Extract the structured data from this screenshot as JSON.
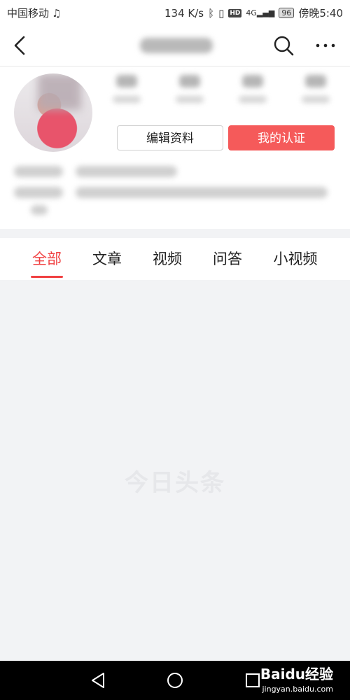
{
  "status_bar": {
    "carrier": "中国移动",
    "speed": "134 K/s",
    "network": "4G",
    "battery": "96",
    "time": "傍晚5:40"
  },
  "nav": {
    "back_icon": "chevron-left-icon",
    "search_icon": "search-icon",
    "more_icon": "more-horizontal-icon"
  },
  "profile": {
    "edit_label": "编辑资料",
    "cert_label": "我的认证"
  },
  "tabs": [
    "全部",
    "文章",
    "视频",
    "问答",
    "小视频"
  ],
  "active_tab": "全部",
  "empty_watermark": "今日头条",
  "system_nav": {
    "back": "triangle-back-icon",
    "home": "circle-home-icon",
    "recent": "square-recent-icon"
  },
  "watermark_brand": {
    "name": "Baidu经验",
    "url": "jingyan.baidu.com"
  },
  "colors": {
    "accent": "#f04142",
    "cert_button": "#f55a5a",
    "page_bg": "#f2f3f5"
  }
}
